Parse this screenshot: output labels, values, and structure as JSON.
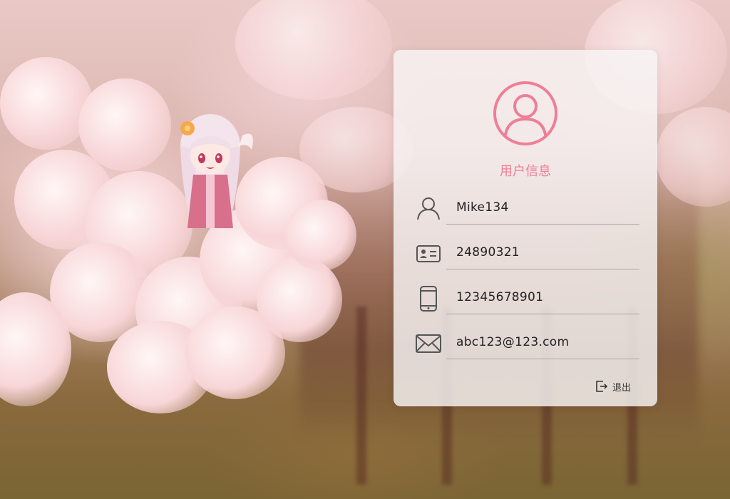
{
  "card": {
    "title": "用户信息"
  },
  "fields": {
    "username": {
      "icon": "user-icon",
      "value": "Mike134"
    },
    "id_number": {
      "icon": "id-card-icon",
      "value": "24890321"
    },
    "phone": {
      "icon": "phone-icon",
      "value": "12345678901"
    },
    "email": {
      "icon": "mail-icon",
      "value": "abc123@123.com"
    }
  },
  "actions": {
    "logout": {
      "icon": "logout-icon",
      "label": "退出"
    }
  },
  "colors": {
    "accent": "#ee7f96",
    "text": "#222222",
    "divider": "#a9a6a6",
    "card_bg": "rgba(248,244,244,0.82)"
  }
}
